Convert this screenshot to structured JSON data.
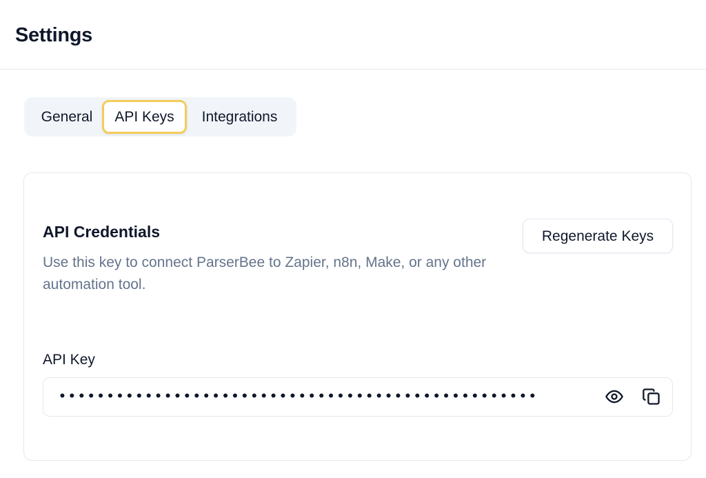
{
  "header": {
    "title": "Settings"
  },
  "tabs": [
    {
      "label": "General",
      "active": false
    },
    {
      "label": "API Keys",
      "active": true
    },
    {
      "label": "Integrations",
      "active": false
    }
  ],
  "card": {
    "title": "API Credentials",
    "description": "Use this key to connect ParserBee to Zapier, n8n, Make, or any other automation tool.",
    "regenerate_label": "Regenerate Keys",
    "api_key": {
      "label": "API Key",
      "masked_value": "••••••••••••••••••••••••••••••••••••••••••••••••••",
      "reveal_icon": "eye-icon",
      "copy_icon": "copy-icon"
    }
  },
  "colors": {
    "active_tab_border": "#f3cc5a",
    "tabs_background": "#f1f5f9",
    "muted_text": "#64748b",
    "border": "#e5e7eb"
  }
}
